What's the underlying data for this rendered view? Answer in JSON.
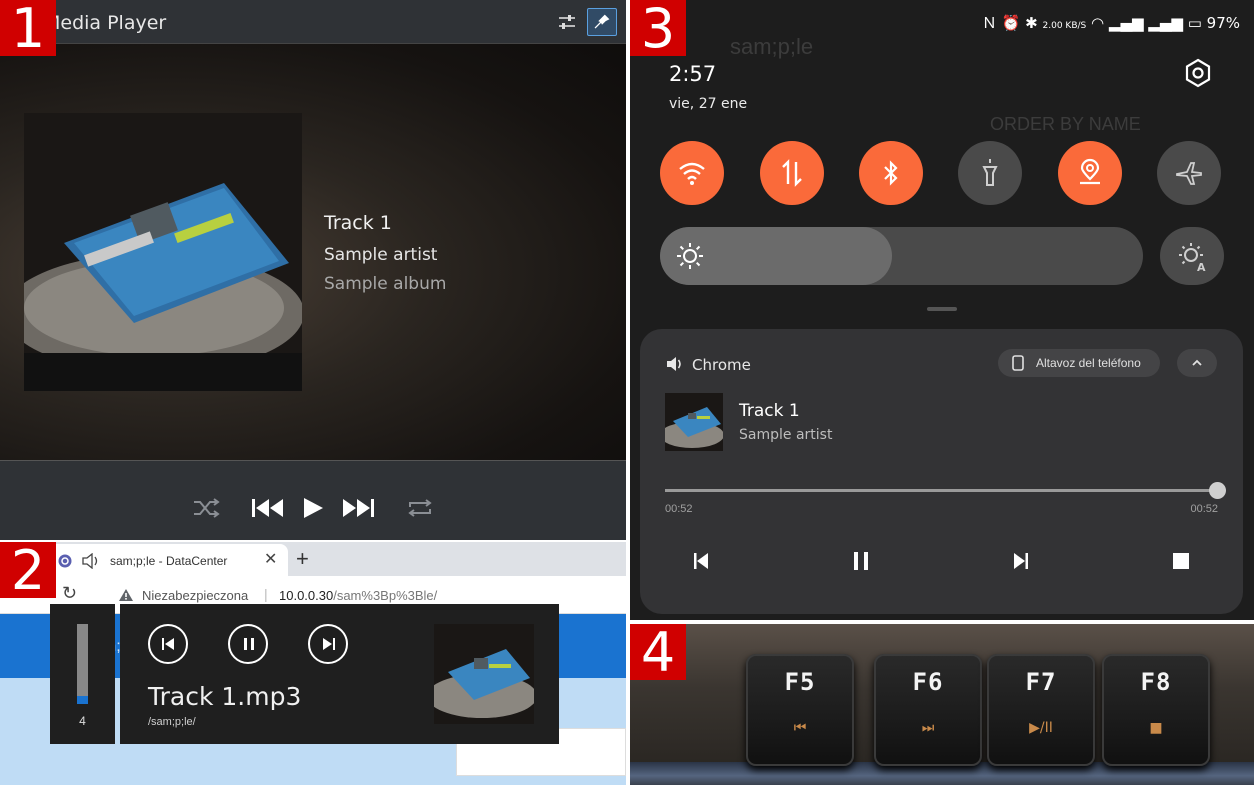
{
  "panel1": {
    "badge": "1",
    "title": "Media Player",
    "track": "Track 1",
    "artist": "Sample artist",
    "album": "Sample album"
  },
  "panel2": {
    "badge": "2",
    "tab_title": "sam;p;le - DataCenter",
    "insecure_label": "Niezabezpieczona",
    "url_host": "10.0.0.30",
    "url_path": "/sam%3Bp%3Ble/",
    "page_heading": "sam;p;le",
    "volume_value": "4",
    "volume_level": 0.1,
    "media_title": "Track 1.mp3",
    "media_path": "/sam;p;le/"
  },
  "panel3": {
    "badge": "3",
    "status_speed": "2.00 KB/S",
    "battery": "97%",
    "time": "2:57",
    "date": "vie, 27 ene",
    "bg_text": "sam;p;le",
    "bg_order": "ORDER BY NAME",
    "brightness_level": 0.48,
    "app_name": "Chrome",
    "output_device": "Altavoz del teléfono",
    "track": "Track 1",
    "artist": "Sample artist",
    "position": "00:52",
    "duration": "00:52",
    "progress": 1.0,
    "accent": "#fa6a3a"
  },
  "panel4": {
    "badge": "4",
    "keys": [
      "F5",
      "F6",
      "F7",
      "F8"
    ],
    "key_icons": [
      "⏮",
      "⏭",
      "▶/II",
      "■"
    ]
  }
}
